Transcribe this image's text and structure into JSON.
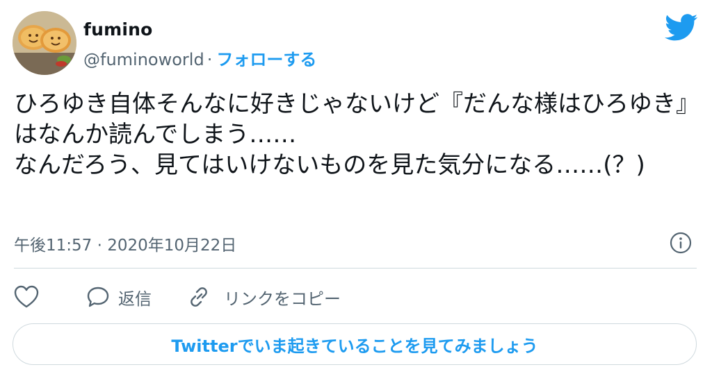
{
  "user": {
    "display_name": "fumino",
    "handle": "@fuminoworld",
    "separator": "·",
    "follow_label": "フォローする"
  },
  "tweet": {
    "text": "ひろゆき自体そんなに好きじゃないけど『だんな様はひろゆき』はなんか読んでしまう……\nなんだろう、見てはいけないものを見た気分になる……(？)",
    "timestamp": "午後11:57 · 2020年10月22日"
  },
  "actions": {
    "like_icon": "heart-icon",
    "reply_label": "返信",
    "reply_icon": "speech-bubble-icon",
    "copy_link_label": "リンクをコピー",
    "copy_link_icon": "link-icon"
  },
  "cta": {
    "label": "Twitterでいま起きていることを見てみましょう"
  },
  "icons": {
    "brand": "twitter-bird-icon",
    "info": "info-icon"
  },
  "colors": {
    "accent": "#1d9bf0",
    "text_primary": "#0f1419",
    "text_secondary": "#536471",
    "border": "#cfd9de"
  }
}
